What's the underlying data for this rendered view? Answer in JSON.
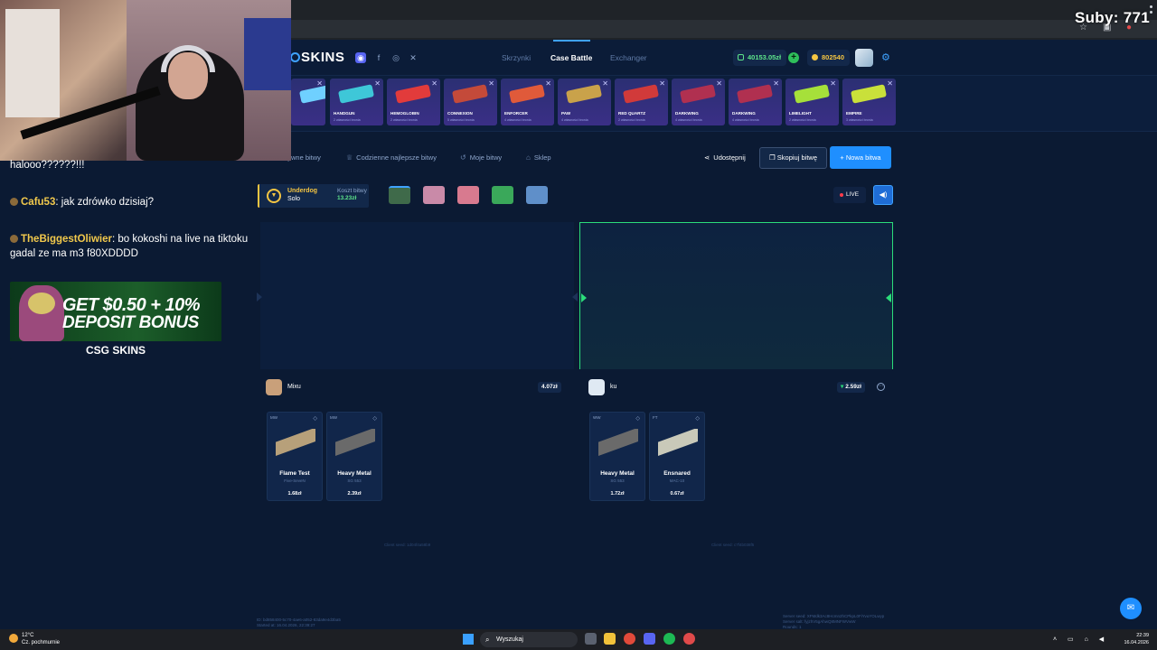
{
  "overlay": {
    "subs_counter": "Suby: 771",
    "chat": [
      {
        "user": "",
        "message": "halooo??????!!!"
      },
      {
        "user": "Cafu53",
        "message": ": jak zdrówko dzisiaj?"
      },
      {
        "user": "TheBiggestOliwier",
        "message": ": bo kokoshi na live na tiktoku gadal ze ma m3 f80XDDDD"
      }
    ],
    "ad": {
      "line1": "GET $0.50 + 10%",
      "line2": "DEPOSIT BONUS",
      "brand": "CSG SKINS"
    }
  },
  "header": {
    "logo": "SKINS",
    "nav": [
      "Skrzynki",
      "Case Battle",
      "Exchanger"
    ],
    "balance_cash": "40153.05zł",
    "balance_coins": "802540"
  },
  "cases": [
    {
      "name": "",
      "sub": "",
      "color": "#6fd0ff"
    },
    {
      "name": "HANDGUN",
      "sub": "2 własności bronia",
      "color": "#3ec7d8"
    },
    {
      "name": "HEMOGLOBIN",
      "sub": "2 własności bronia",
      "color": "#e23b3b"
    },
    {
      "name": "CONNEXION",
      "sub": "5 własności bronia",
      "color": "#c44a3a"
    },
    {
      "name": "ENFORCER",
      "sub": "4 własności bronia",
      "color": "#e05a3a"
    },
    {
      "name": "PAW",
      "sub": "4 własności bronia",
      "color": "#c9a24a"
    },
    {
      "name": "RED QUARTZ",
      "sub": "2 własności bronia",
      "color": "#d13a3a"
    },
    {
      "name": "DARKWING",
      "sub": "4 własności bronia",
      "color": "#b03050"
    },
    {
      "name": "DARKWING",
      "sub": "4 własności bronia",
      "color": "#b03050"
    },
    {
      "name": "LIMELIGHT",
      "sub": "2 własności bronia",
      "color": "#a6e03a"
    },
    {
      "name": "EMPIRE",
      "sub": "3 własności bronia",
      "color": "#c9e03a"
    }
  ],
  "toolbar": {
    "links": [
      "...ywne bitwy",
      "Codzienne najlepsze bitwy",
      "Moje bitwy",
      "Sklep"
    ],
    "share": "Udostępnij",
    "copy": "Skopiuj bitwę",
    "new": "+ Nowa bitwa"
  },
  "battle": {
    "mode_name": "Underdog",
    "mode_type": "Solo",
    "cost_label": "Koszt bitwy",
    "cost_value": "13.23zł",
    "mini_cases": [
      "#3f6a4a",
      "#c98aa8",
      "#d87a8f",
      "#3aa85a",
      "#5f8fc9"
    ],
    "live": "LIVE"
  },
  "players": [
    {
      "name": "Mixu",
      "total": "4.07zł",
      "avatar_color": "#c9a07a"
    },
    {
      "name": "ku",
      "total": "2.59zł",
      "avatar_color": "#dfe9f3"
    }
  ],
  "items": [
    {
      "cond": "MW",
      "name": "Flame Test",
      "skin": "Five-SeveN",
      "price": "1.68zł",
      "color": "#b7a07a"
    },
    {
      "cond": "MW",
      "name": "Heavy Metal",
      "skin": "SG 553",
      "price": "2.39zł",
      "color": "#6a6a6a"
    },
    {
      "cond": "WW",
      "name": "Heavy Metal",
      "skin": "SG 553",
      "price": "1.72zł",
      "color": "#6a6a6a"
    },
    {
      "cond": "FT",
      "name": "Ensnared",
      "skin": "MAC-10",
      "price": "0.67zł",
      "color": "#c9c9b9"
    }
  ],
  "seeds": {
    "left": "Client seed: 1d04f4a58b9",
    "right": "Client seed: c7f4b038f5",
    "footer_left": "ID: bd858400-5c70-4ae6-a052-83da9e4d3ba5\nStarted at: 16.04.2026, 22:39:27",
    "footer_right": "Server seed: XFMdk3Ac8Hcmn2hCPkpL0FiYvuYOLwyp\nServer salt: fyjzhV5gAhwQ8MNFWVwW\nRounds: 1"
  },
  "taskbar": {
    "temp": "12°C",
    "weather": "Cz. pochmurnie",
    "search": "Wyszukaj",
    "time": "22:39",
    "date": "16.04.2026"
  }
}
